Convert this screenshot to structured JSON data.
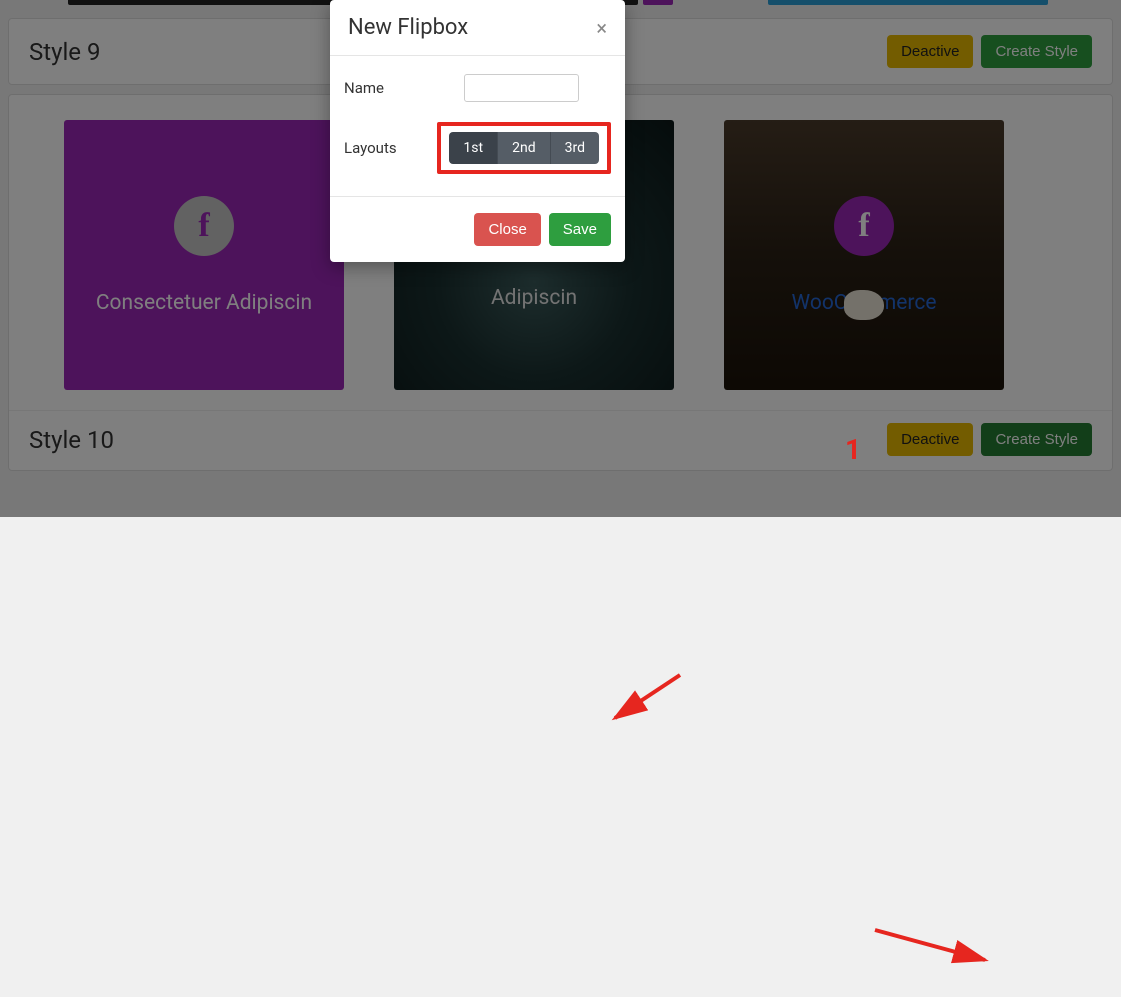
{
  "panel9": {
    "title": "Style 9",
    "deactive_label": "Deactive",
    "create_label": "Create Style"
  },
  "panel10": {
    "title": "Style 10",
    "deactive_label": "Deactive",
    "create_label": "Create Style",
    "cards": [
      {
        "title": "Consectetuer Adipiscin"
      },
      {
        "title": "Adipiscin"
      },
      {
        "title": "WooCommerce"
      }
    ]
  },
  "modal": {
    "title": "New Flipbox",
    "close_glyph": "×",
    "name_label": "Name",
    "name_value": "",
    "layouts_label": "Layouts",
    "layouts": {
      "opt1": "1st",
      "opt2": "2nd",
      "opt3": "3rd"
    },
    "close_btn": "Close",
    "save_btn": "Save"
  },
  "annotation": {
    "num": "1"
  },
  "icons": {
    "facebook": "f"
  }
}
